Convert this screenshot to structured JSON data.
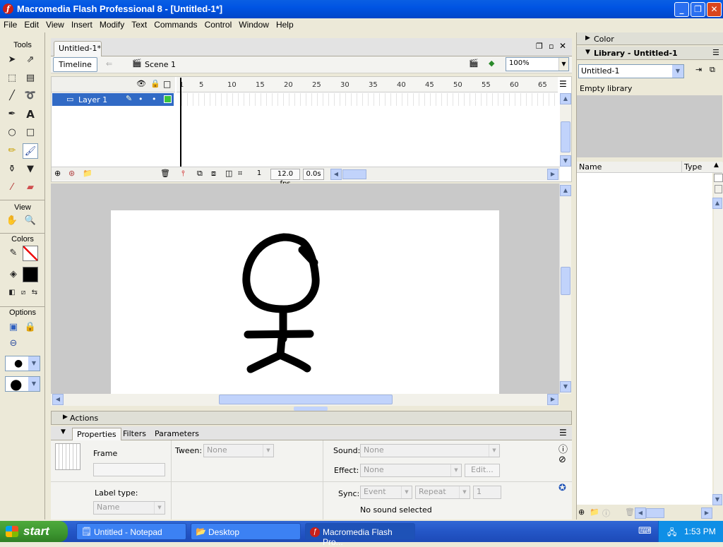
{
  "window": {
    "title": "Macromedia Flash Professional 8 - [Untitled-1*]",
    "minimize": "_",
    "maximize": "❐",
    "close": "✕"
  },
  "menu": [
    "File",
    "Edit",
    "View",
    "Insert",
    "Modify",
    "Text",
    "Commands",
    "Control",
    "Window",
    "Help"
  ],
  "tools": {
    "title": "Tools",
    "view_label": "View",
    "colors_label": "Colors",
    "options_label": "Options"
  },
  "document": {
    "tab": "Untitled-1*",
    "timeline_button": "Timeline",
    "scene": "Scene 1",
    "zoom": "100%"
  },
  "timeline": {
    "layer_name": "Layer 1",
    "ticks": [
      "1",
      "5",
      "10",
      "15",
      "20",
      "25",
      "30",
      "35",
      "40",
      "45",
      "50",
      "55",
      "60",
      "65"
    ],
    "current_frame": "1",
    "fps": "12.0 fps",
    "elapsed": "0.0s"
  },
  "panels": {
    "actions": "Actions",
    "tabs": [
      "Properties",
      "Filters",
      "Parameters"
    ]
  },
  "properties": {
    "frame_label": "Frame",
    "label_type": "Label type:",
    "label_type_value": "Name",
    "tween_label": "Tween:",
    "tween_value": "None",
    "sound_label": "Sound:",
    "sound_value": "None",
    "effect_label": "Effect:",
    "effect_value": "None",
    "edit_button": "Edit...",
    "sync_label": "Sync:",
    "sync_value": "Event",
    "repeat_value": "Repeat",
    "repeat_count": "1",
    "no_sound": "No sound selected"
  },
  "right": {
    "color_panel": "Color",
    "library_panel": "Library - Untitled-1",
    "library_select": "Untitled-1",
    "empty_library": "Empty library",
    "col_name": "Name",
    "col_type": "Type"
  },
  "taskbar": {
    "start": "start",
    "tasks": [
      "Untitled - Notepad",
      "Desktop",
      "Macromedia Flash Pro..."
    ],
    "clock": "1:53 PM"
  }
}
